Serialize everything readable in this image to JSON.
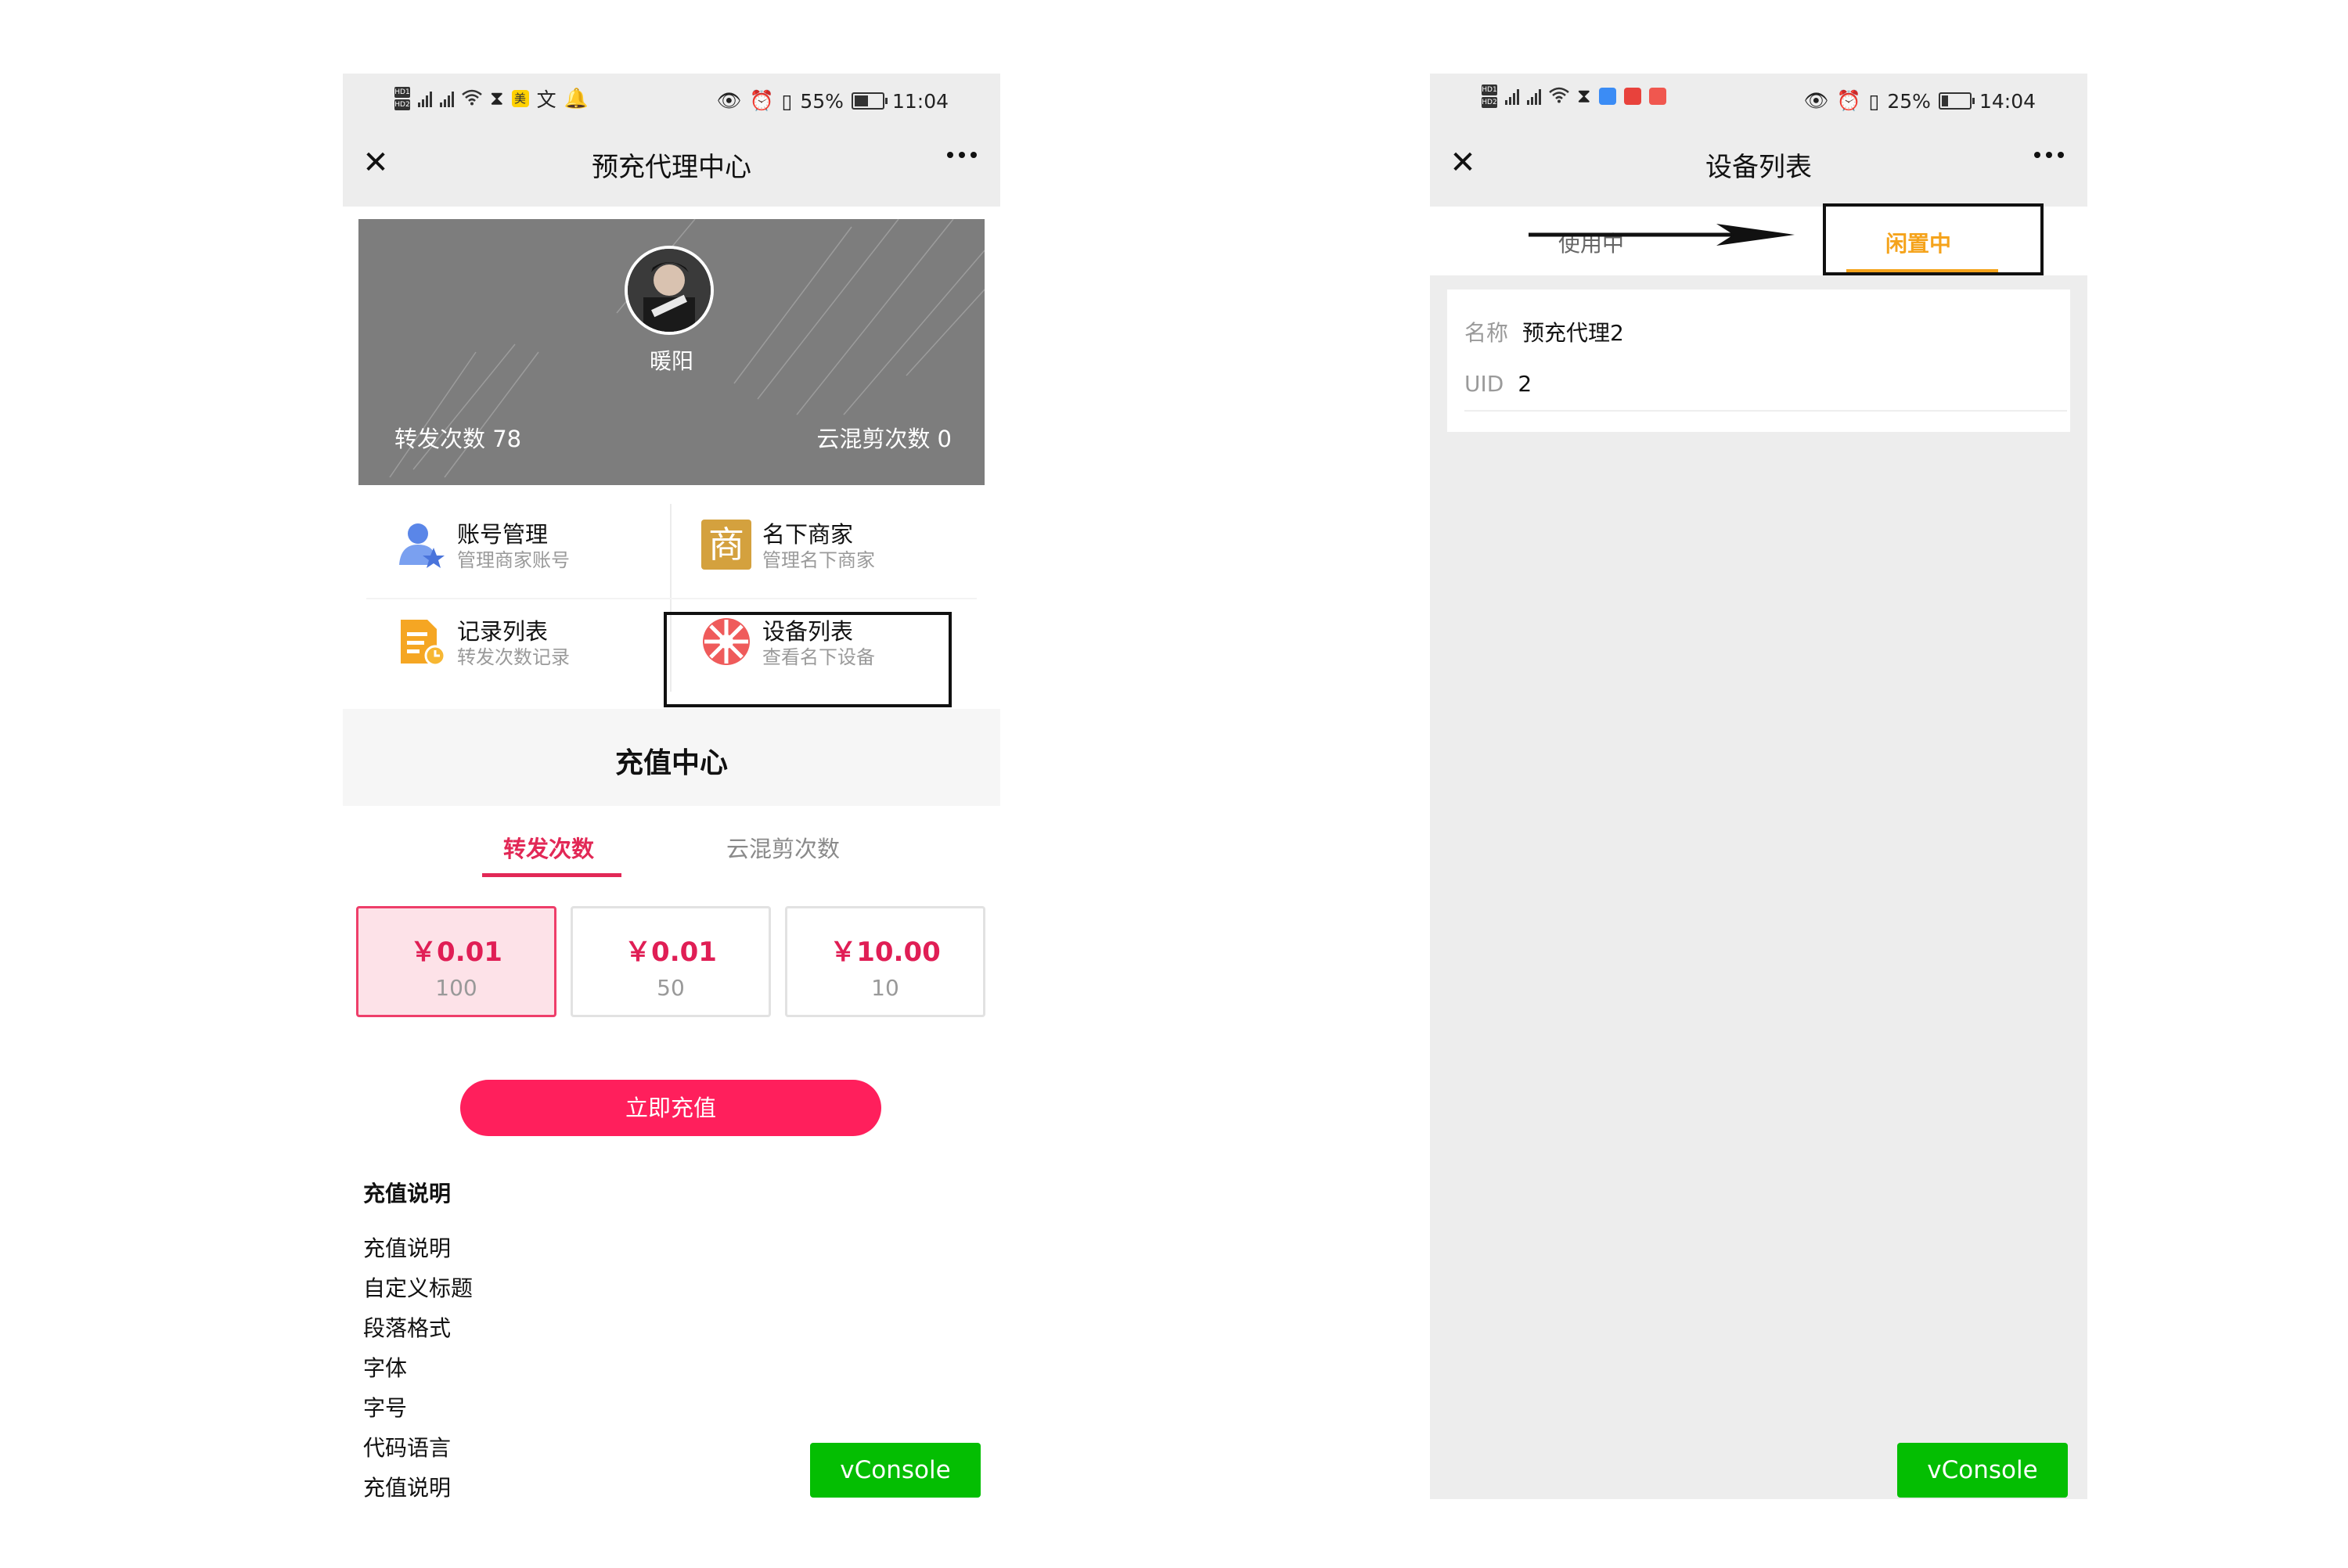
{
  "left": {
    "status": {
      "percent": "55%",
      "time": "11:04",
      "battery_level": 0.55
    },
    "nav": {
      "title": "预充代理中心"
    },
    "banner": {
      "nickname": "暖阳",
      "forward_label": "转发次数 78",
      "cloud_label": "云混剪次数 0"
    },
    "menu": [
      {
        "title": "账号管理",
        "subtitle": "管理商家账号",
        "icon": "account-icon"
      },
      {
        "title": "名下商家",
        "subtitle": "管理名下商家",
        "icon": "merchant-icon",
        "glyph": "商"
      },
      {
        "title": "记录列表",
        "subtitle": "转发次数记录",
        "icon": "records-icon"
      },
      {
        "title": "设备列表",
        "subtitle": "查看名下设备",
        "icon": "device-icon"
      }
    ],
    "recharge": {
      "title": "充值中心",
      "tabs": [
        "转发次数",
        "云混剪次数"
      ],
      "packages": [
        {
          "price": "￥0.01",
          "count": "100"
        },
        {
          "price": "￥0.01",
          "count": "50"
        },
        {
          "price": "￥10.00",
          "count": "10"
        }
      ],
      "button": "立即充值",
      "notes_title": "充值说明",
      "notes": [
        "充值说明",
        "自定义标题",
        "段落格式",
        "字体",
        "字号",
        "代码语言",
        "充值说明"
      ]
    },
    "vconsole": "vConsole"
  },
  "right": {
    "status": {
      "percent": "25%",
      "time": "14:04",
      "battery_level": 0.25
    },
    "nav": {
      "title": "设备列表"
    },
    "tabs": [
      "使用中",
      "闲置中"
    ],
    "device": {
      "name_key": "名称",
      "name_value": "预充代理2",
      "uid_key": "UID",
      "uid_value": "2"
    },
    "vconsole": "vConsole"
  },
  "colors": {
    "accent_pink": "#ff1f5c",
    "accent_orange": "#f5a31b",
    "vconsole_green": "#04be02",
    "banner_gray": "#7d7d7d"
  }
}
